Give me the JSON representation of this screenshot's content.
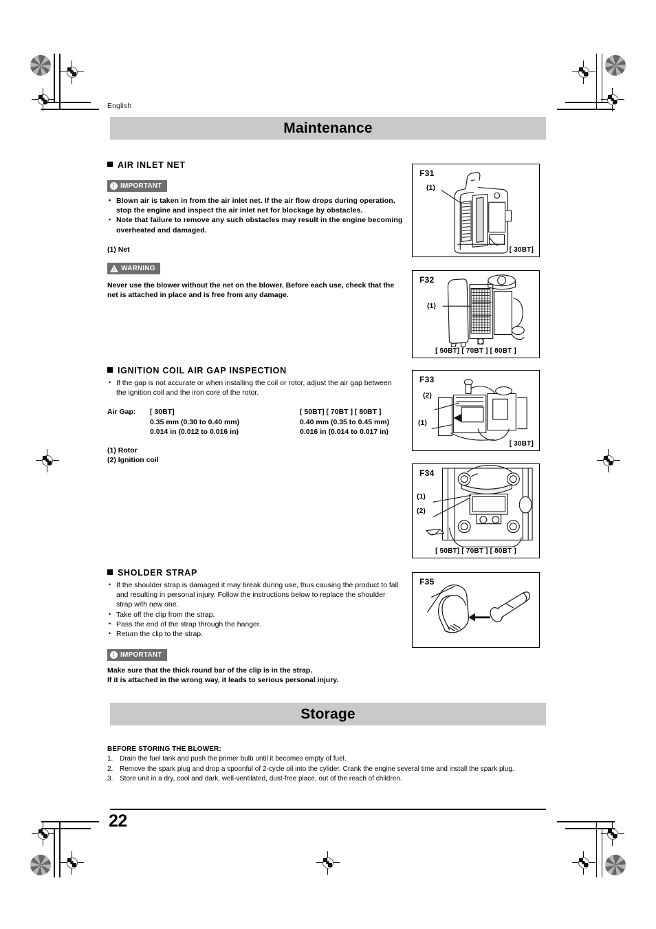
{
  "page": {
    "language_label": "English",
    "page_number": "22"
  },
  "banners": {
    "maintenance": "Maintenance",
    "storage": "Storage"
  },
  "sections": {
    "air_inlet_net": {
      "heading": "AIR INLET NET",
      "important_badge": "IMPORTANT",
      "bullets": [
        "Blown air is taken in from the air inlet net. If the air flow drops during operation, stop the engine and inspect the air inlet net for blockage by obstacles.",
        "Note that failure to remove any such obstacles may result in the engine becoming overheated and damaged."
      ],
      "legend": [
        "(1) Net"
      ],
      "warning_badge": "WARNING",
      "warning_text": "Never use the blower without the net on the blower. Before each use, check that the net is attached in place and is free from any damage."
    },
    "ignition_coil": {
      "heading": "IGNITION COIL AIR GAP INSPECTION",
      "bullets": [
        "If the gap is not accurate or when installing the coil or rotor, adjust the air gap between the ignition coil and the iron core of the rotor."
      ],
      "air_gap_label": "Air Gap:",
      "air_gap_col1": {
        "models": "[  30BT]",
        "metric": "0.35 mm (0.30 to 0.40 mm)",
        "imperial": "0.014 in (0.012 to 0.016 in)"
      },
      "air_gap_col2": {
        "models": "[  50BT] [  70BT  ] [  80BT  ]",
        "metric": "0.40 mm (0.35 to 0.45 mm)",
        "imperial": "0.016 in (0.014 to 0.017 in)"
      },
      "legend": [
        "(1) Rotor",
        "(2) Ignition coil"
      ]
    },
    "sholder_strap": {
      "heading": "SHOLDER STRAP",
      "bullets": [
        "If the shoulder strap is damaged it may break during use, thus causing the product to fall and resulting in personal injury. Follow the instructions below to replace the shoulder strap with new one.",
        "Take off the clip from the strap.",
        "Pass the end of the strap through the hanger.",
        "Return the clip to the strap."
      ],
      "important_badge": "IMPORTANT",
      "important_lines": [
        "Make sure that the thick round bar of the clip is in the strap.",
        "If it is attached in the wrong way, it leads to serious personal injury."
      ]
    },
    "storage": {
      "heading": "BEFORE STORING THE BLOWER:",
      "steps": [
        {
          "n": "1.",
          "text": "Drain the fuel tank and push the primer bulb until it becomes empty of fuel."
        },
        {
          "n": "2.",
          "text": "Remove the spark plug and drop a spoonful of 2-cycle oil into the cylider. Crank the engine several time and install the spark plug."
        },
        {
          "n": "3.",
          "text": "Store unit in a dry, cool and dark, well-ventilated, dust-free place, out of the reach of children."
        }
      ]
    }
  },
  "figures": [
    {
      "id": "F31",
      "label": "F31",
      "model_tag": "[  30BT]",
      "callouts": [
        "(1)"
      ]
    },
    {
      "id": "F32",
      "label": "F32",
      "model_tag": "[  50BT] [  70BT  ] [  80BT  ]",
      "callouts": [
        "(1)"
      ]
    },
    {
      "id": "F33",
      "label": "F33",
      "model_tag": "[  30BT]",
      "callouts": [
        "(2)",
        "(1)"
      ]
    },
    {
      "id": "F34",
      "label": "F34",
      "model_tag": "[  50BT] [  70BT  ] [  80BT  ]",
      "callouts": [
        "(1)",
        "(2)"
      ]
    },
    {
      "id": "F35",
      "label": "F35",
      "model_tag": "",
      "callouts": []
    }
  ],
  "colors": {
    "banner_bg": "#c9c9c9",
    "badge_bg": "#6e6e6e",
    "text": "#000000"
  }
}
